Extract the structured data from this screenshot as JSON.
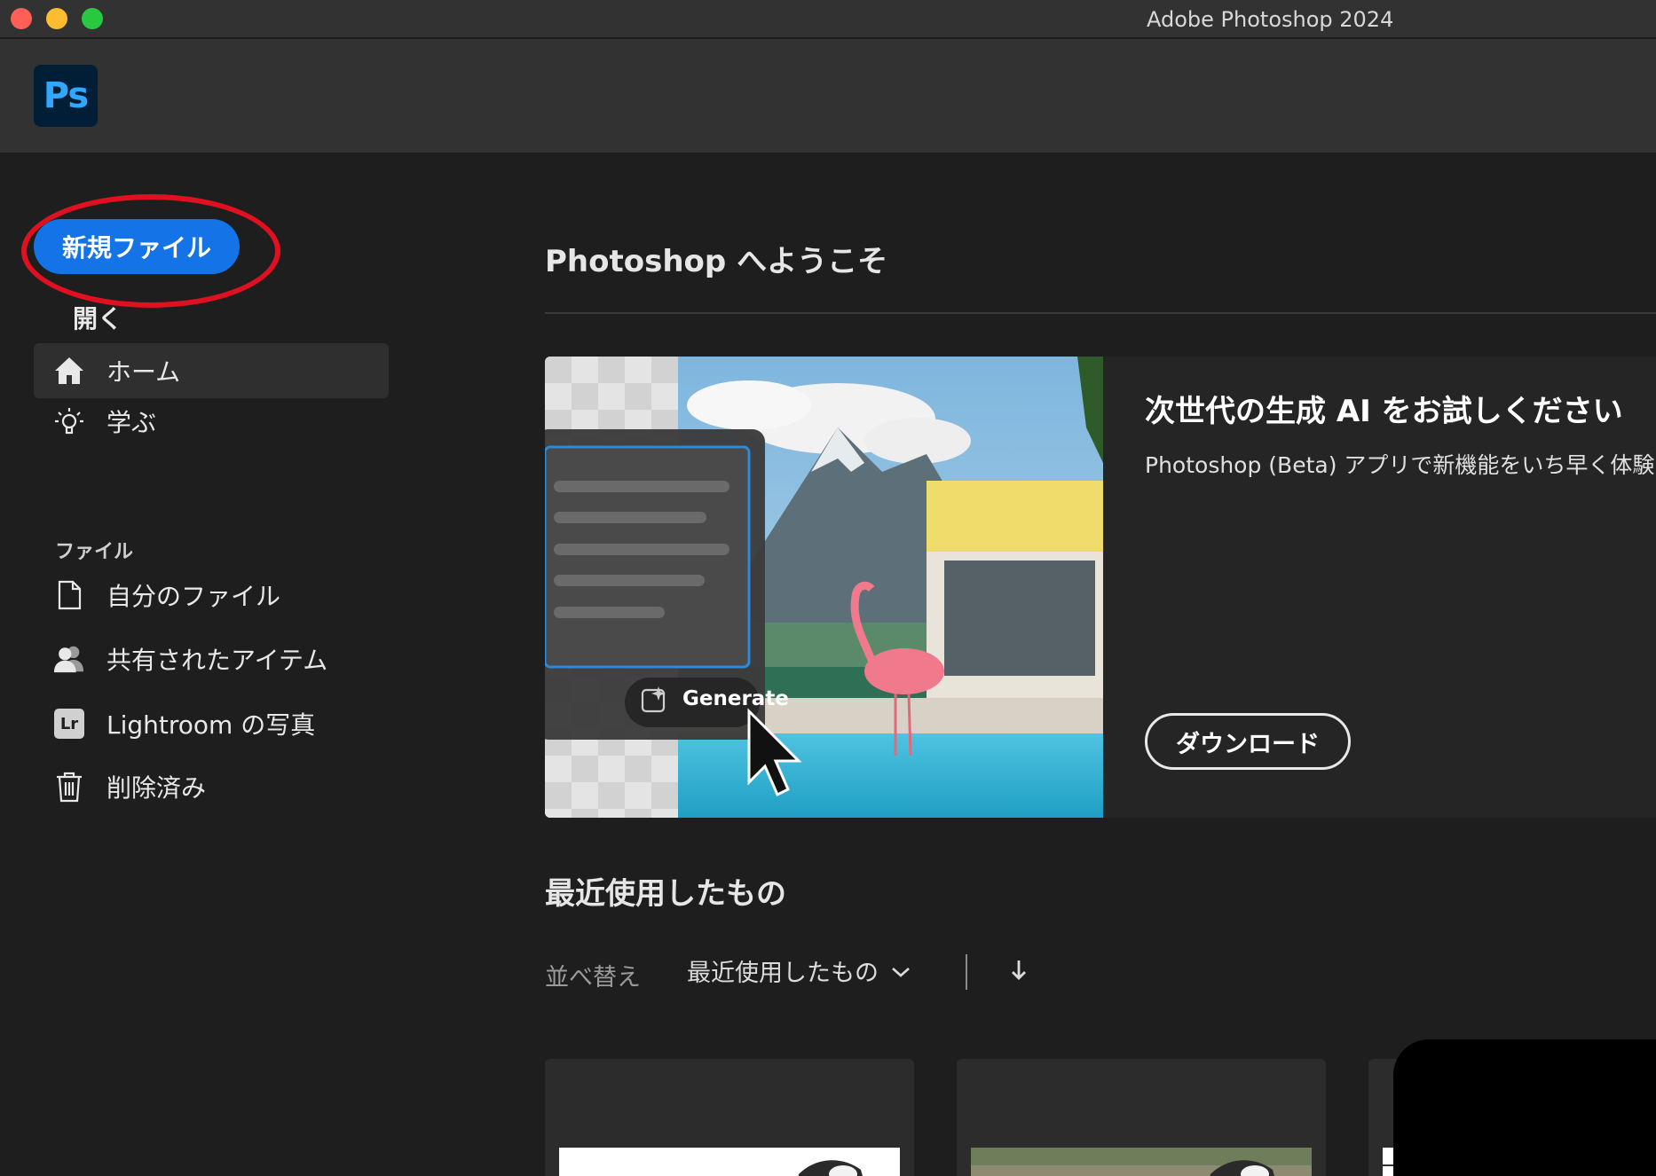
{
  "window": {
    "title": "Adobe Photoshop 2024"
  },
  "app": {
    "logo_text": "Ps"
  },
  "sidebar": {
    "new_file_label": "新規ファイル",
    "open_label": "開く",
    "items": [
      {
        "label": "ホーム",
        "icon": "home-icon",
        "active": true
      },
      {
        "label": "学ぶ",
        "icon": "lightbulb-icon"
      }
    ],
    "files_section_label": "ファイル",
    "file_items": [
      {
        "label": "自分のファイル",
        "icon": "document-icon"
      },
      {
        "label": "共有されたアイテム",
        "icon": "people-icon"
      },
      {
        "label": "Lightroom の写真",
        "icon": "lightroom-icon",
        "badge": "Lr"
      },
      {
        "label": "削除済み",
        "icon": "trash-icon"
      }
    ]
  },
  "main": {
    "welcome_title": "Photoshop へようこそ",
    "promo": {
      "title": "次世代の生成 AI をお試しください",
      "subtitle": "Photoshop (Beta) アプリで新機能をいち早く体験",
      "generate_label": "Generate",
      "download_label": "ダウンロード"
    },
    "recent": {
      "title": "最近使用したもの",
      "sort_label": "並べ替え",
      "sort_value": "最近使用したもの"
    }
  },
  "colors": {
    "accent": "#1473e6",
    "annotation": "#e01020",
    "ps_blue": "#31a8ff"
  }
}
